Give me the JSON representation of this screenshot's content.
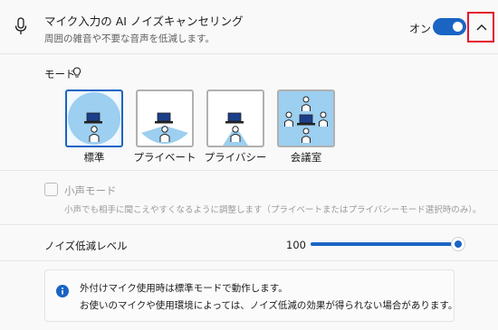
{
  "header": {
    "title": "マイク入力の AI ノイズキャンセリング",
    "subtitle": "周囲の雑音や不要な音声を低減します。",
    "toggle_label": "オン",
    "toggle_on": true
  },
  "mode": {
    "label": "モード",
    "options": [
      {
        "label": "標準",
        "selected": true
      },
      {
        "label": "プライベート",
        "selected": false
      },
      {
        "label": "プライバシー",
        "selected": false
      },
      {
        "label": "会議室",
        "selected": false
      }
    ]
  },
  "quiet_mode": {
    "label": "小声モード",
    "description": "小声でも相手に聞こえやすくなるように調整します（プライベートまたはプライバシーモード選択時のみ）。",
    "checked": false,
    "enabled": false
  },
  "noise_level": {
    "label": "ノイズ低減レベル",
    "value": "100"
  },
  "info": {
    "line1": "外付けマイク使用時は標準モードで動作します。",
    "line2": "お使いのマイクや使用環境によっては、ノイズ低減の効果が得られない場合があります。"
  },
  "colors": {
    "accent": "#1a64c4",
    "highlight_border": "#e3162c",
    "beam": "#9ccff0"
  },
  "icons": [
    "microphone-icon",
    "chevron-up-icon",
    "lightbulb-icon",
    "info-icon",
    "laptop-icon",
    "person-icon"
  ]
}
